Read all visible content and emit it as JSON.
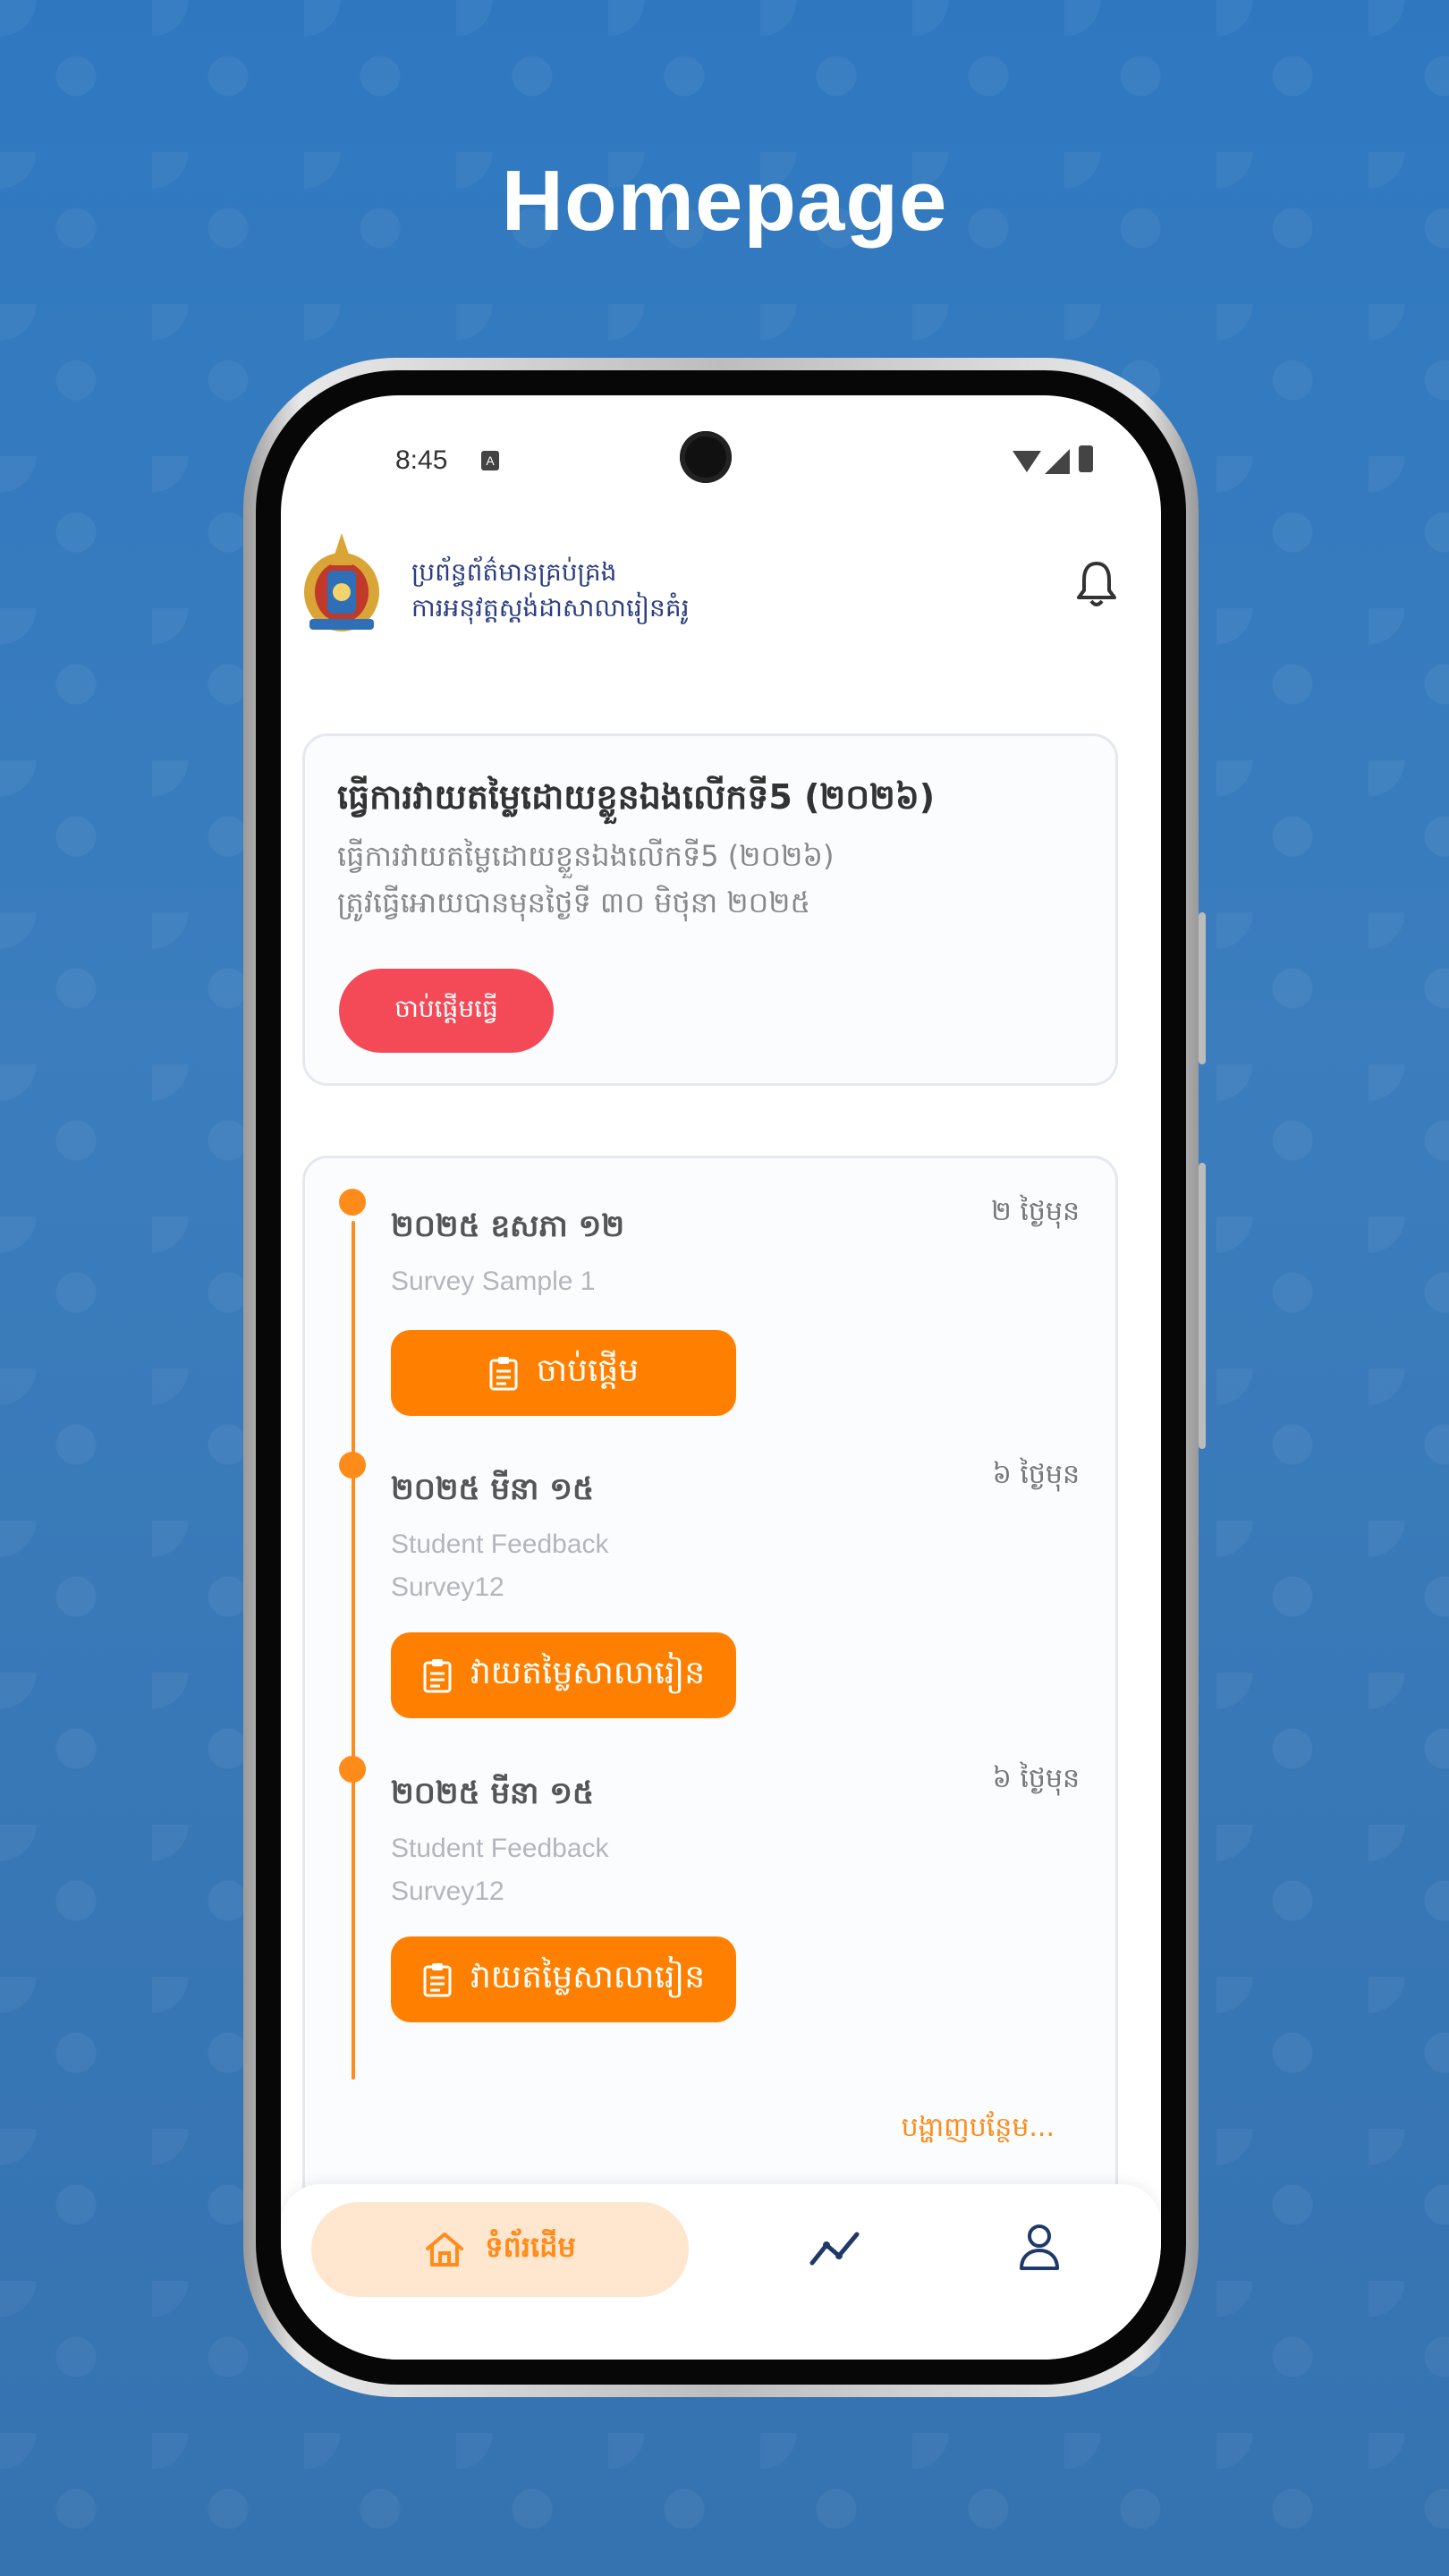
{
  "headline": "Homepage",
  "status_bar": {
    "time": "8:45",
    "indicator": "A"
  },
  "app_header": {
    "title_line1": "ប្រព័ន្ធព័ត៌មានគ្រប់គ្រង",
    "title_line2": "ការអនុវត្តស្តង់ដាសាលារៀនគំរូ",
    "logo_icon": "emblem-logo",
    "notification_icon": "bell-icon"
  },
  "self_eval_card": {
    "title": "ធ្វើការវាយតម្លៃដោយខ្លួនឯងលើកទី5 (២០២៦)",
    "subtitle": "ធ្វើការវាយតម្លៃដោយខ្លួនឯងលើកទី5 (២០២៦)",
    "deadline": "ត្រូវធ្វើអោយបានមុនថ្ងៃទី ៣០ មិថុនា ២០២៥",
    "start_label": "ចាប់ផ្តើមធ្វើ",
    "accent": "#f44a58"
  },
  "timeline": {
    "accent": "#ff8000",
    "items": [
      {
        "date": "២០២៥ ឧសភា ១២",
        "ago": "២ ថ្ងៃមុន",
        "name": "Survey Sample 1",
        "button_label": "ចាប់ផ្តើម"
      },
      {
        "date": "២០២៥ មីនា ១៥",
        "ago": "៦ ថ្ងៃមុន",
        "name": "Student Feedback Survey12",
        "button_label": "វាយតម្លៃសាលារៀន"
      },
      {
        "date": "២០២៥ មីនា ១៥",
        "ago": "៦ ថ្ងៃមុន",
        "name": "Student Feedback Survey12",
        "button_label": "វាយតម្លៃសាលារៀន"
      }
    ],
    "show_more": "បង្ហាញបន្ថែម..."
  },
  "bottom_nav": {
    "home_label": "ទំព័រដើម",
    "home_icon": "home-icon",
    "stats_icon": "trend-chart-icon",
    "profile_icon": "user-icon"
  }
}
